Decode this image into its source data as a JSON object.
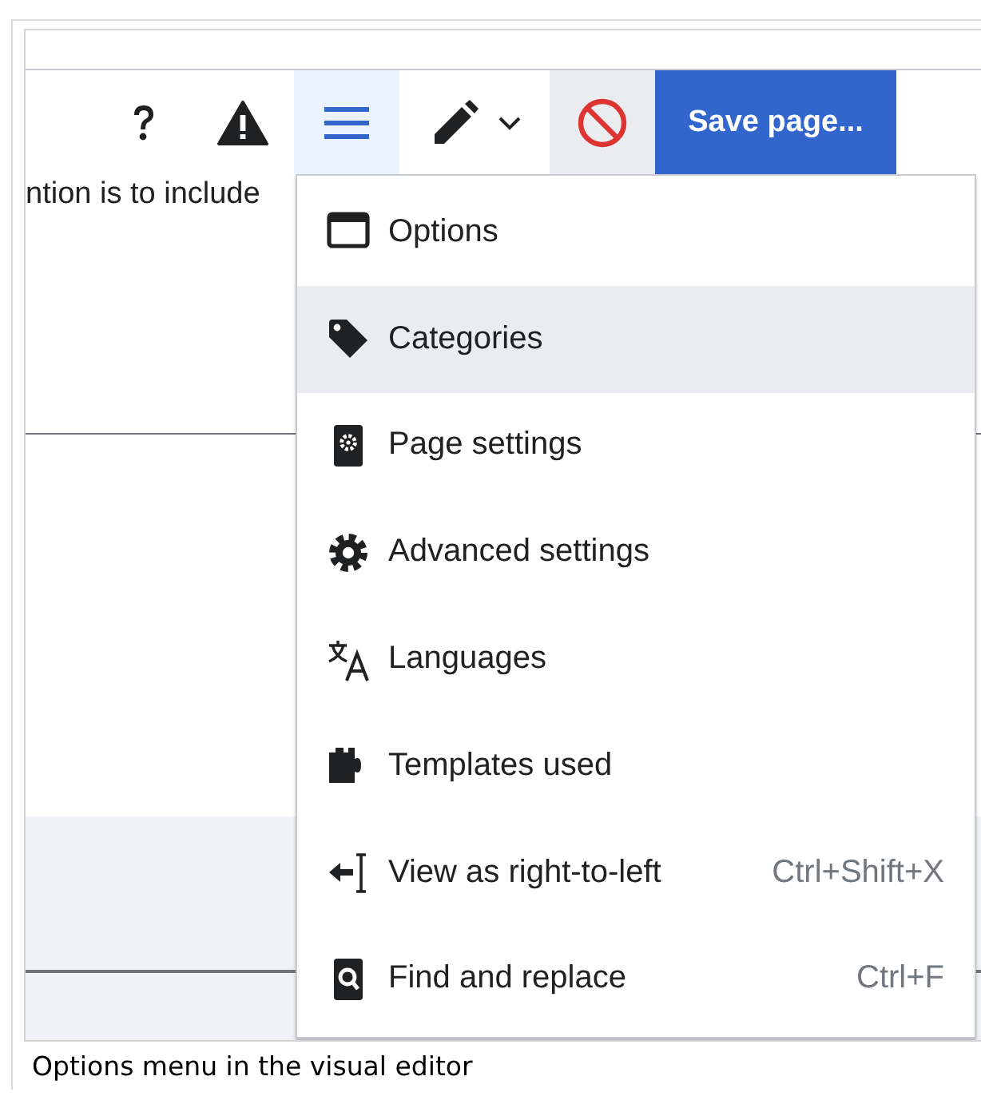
{
  "toolbar": {
    "buttons": [
      {
        "kind": "help",
        "active": false
      },
      {
        "kind": "notices",
        "active": false
      },
      {
        "kind": "menu",
        "active": true
      },
      {
        "kind": "edit-mode",
        "active": false
      },
      {
        "kind": "cancel",
        "active": false
      },
      {
        "kind": "save",
        "label": "Save page...",
        "active": false
      }
    ]
  },
  "content": {
    "text": "ntion is to include"
  },
  "menu": {
    "items": [
      {
        "label": "Options",
        "selected": false
      },
      {
        "label": "Categories",
        "selected": true
      },
      {
        "label": "Page settings",
        "selected": false
      },
      {
        "label": "Advanced settings",
        "selected": false
      },
      {
        "label": "Languages",
        "selected": false
      },
      {
        "label": "Templates used",
        "selected": false
      },
      {
        "label": "View as right-to-left",
        "shortcut": "Ctrl+Shift+X",
        "selected": false
      },
      {
        "label": "Find and replace",
        "shortcut": "Ctrl+F",
        "selected": false
      }
    ]
  },
  "caption": "Options menu in the visual editor"
}
